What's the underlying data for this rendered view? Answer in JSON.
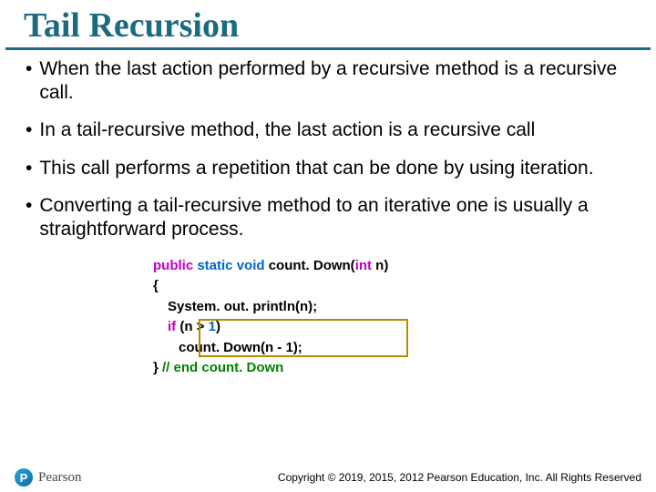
{
  "title": "Tail Recursion",
  "bullets": [
    "When the last action performed by a recursive method is a recursive call.",
    "In a tail-recursive method, the last action is a recursive call",
    "This call performs a repetition that can be done by using iteration.",
    "Converting a tail-recursive method to an iterative one is usually a straightforward process."
  ],
  "code": {
    "sig_public": "public",
    "sig_static_void": "static void",
    "sig_name": " count. Down(",
    "sig_param_type": "int",
    "sig_param_name": " n)",
    "open_brace": "{",
    "line_print": "System. out. println(n);",
    "if_kw": "if",
    "if_cond_open": " (n > ",
    "if_cond_num": "1",
    "if_cond_close": ")",
    "call_line": "count. Down(n - 1);",
    "close_brace": "} ",
    "end_comment": "// end count. Down"
  },
  "logo": {
    "mark": "P",
    "text": "Pearson"
  },
  "copyright": "Copyright © 2019, 2015, 2012 Pearson Education, Inc. All Rights Reserved"
}
